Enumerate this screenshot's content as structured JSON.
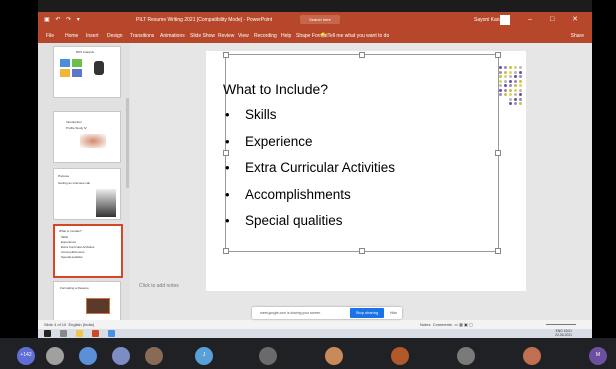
{
  "titlebar": {
    "title": "PILT Resume Writing 2021 [Compatibility Mode] - PowerPoint",
    "search": "Search here",
    "user": "Sayoni Kana"
  },
  "ribbon": {
    "tabs": [
      "File",
      "Home",
      "Insert",
      "Design",
      "Transitions",
      "Animations",
      "Slide Show",
      "Review",
      "View",
      "Recording",
      "Help",
      "Shape Format"
    ],
    "tell_me": "Tell me what you want to do",
    "share": "Share"
  },
  "thumbnails": [
    {
      "num": "",
      "title": "RPS Analysis",
      "selected": false
    },
    {
      "num": "",
      "title": "Introduction",
      "subtitle": "Profile Study IV",
      "selected": false
    },
    {
      "num": "",
      "title": "Purpose",
      "subtitle": "Getting an interview call",
      "selected": false
    },
    {
      "num": "",
      "title": "What to Include?",
      "lines": [
        "Skills",
        "Experience",
        "Extra Curricular Activities",
        "Accomplishments",
        "Special qualities"
      ],
      "selected": true
    },
    {
      "num": "",
      "title": "Formatting a Resume",
      "selected": false
    }
  ],
  "slide": {
    "title": "What to Include?",
    "bullets": [
      "Skills",
      "Experience",
      "Extra Curricular Activities",
      "Accomplishments",
      "Special qualities"
    ]
  },
  "notes": {
    "placeholder": "Click to add notes"
  },
  "share_banner": {
    "message": "meet.google.com is sharing your screen.",
    "stop_label": "Stop sharing",
    "hide_label": "Hide"
  },
  "statusbar": {
    "slide_info": "Slide 4 of 10",
    "language": "English (India)",
    "notes_label": "Notes",
    "comments_label": "Comments"
  },
  "taskbar": {
    "time": "15:01",
    "date": "22-06-2021",
    "lang": "ENG"
  },
  "participants": [
    {
      "initials": "+142",
      "color": "#5f6fd6"
    },
    {
      "initials": "",
      "color": "#a0a0a0"
    },
    {
      "initials": "",
      "color": "#5b8fd6"
    },
    {
      "initials": "",
      "color": "#7c8cc4"
    },
    {
      "initials": "",
      "color": "#8a6a55"
    },
    {
      "initials": "J",
      "color": "#5aa0d8"
    },
    {
      "initials": "",
      "color": "#6a6a6a"
    },
    {
      "initials": "",
      "color": "#c98a5a"
    },
    {
      "initials": "",
      "color": "#b05a2a"
    },
    {
      "initials": "",
      "color": "#7a7a7a"
    },
    {
      "initials": "",
      "color": "#c07050"
    },
    {
      "initials": "M",
      "color": "#6b4fa0"
    }
  ],
  "colors": {
    "ppt_accent": "#b7472a",
    "selection_border": "#d24726",
    "meet_bg": "#202124",
    "stop_sharing": "#1a73e8"
  }
}
